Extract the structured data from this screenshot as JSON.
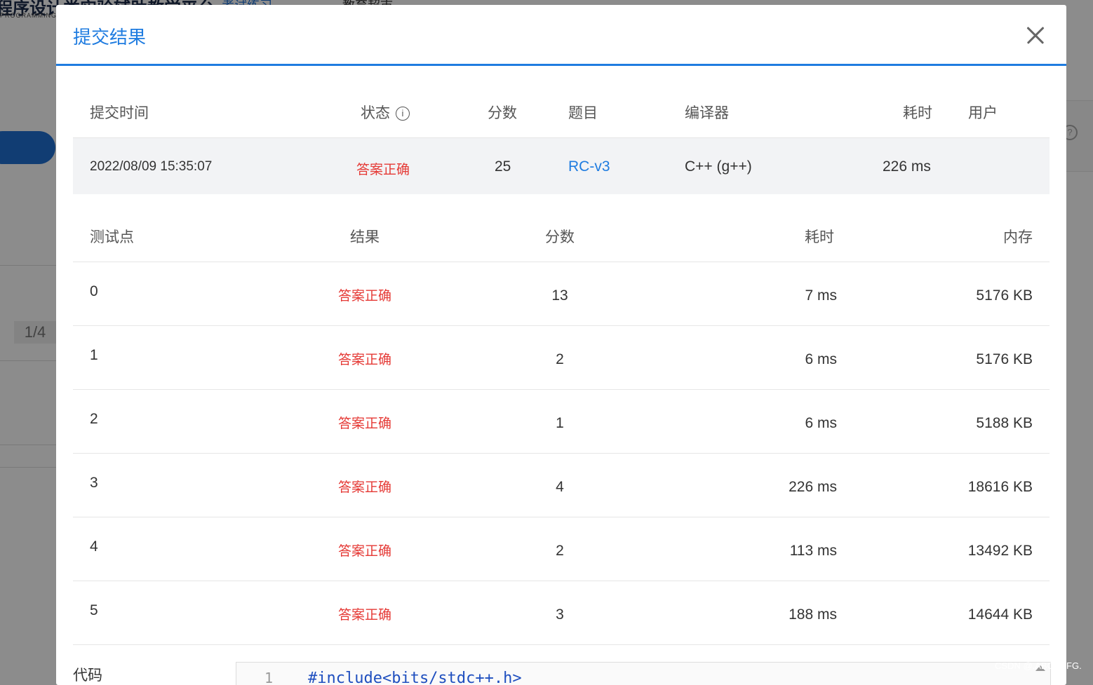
{
  "background": {
    "logo_main": "程序设计类实验辅助教学平台",
    "logo_sub": "PROGRAMMING TEACHING",
    "nav_active": "考试练习",
    "nav_other": "教育超市",
    "page_indicator": "1/4"
  },
  "modal": {
    "title": "提交结果",
    "summary": {
      "headers": {
        "time": "提交时间",
        "status": "状态",
        "score": "分数",
        "problem": "题目",
        "compiler": "编译器",
        "duration": "耗时",
        "user": "用户"
      },
      "row": {
        "time": "2022/08/09 15:35:07",
        "status": "答案正确",
        "score": "25",
        "problem": "RC-v3",
        "compiler": "C++ (g++)",
        "duration": "226 ms",
        "user": ""
      }
    },
    "testpoints": {
      "headers": {
        "id": "测试点",
        "result": "结果",
        "score": "分数",
        "duration": "耗时",
        "memory": "内存"
      },
      "rows": [
        {
          "id": "0",
          "result": "答案正确",
          "score": "13",
          "duration": "7 ms",
          "memory": "5176 KB"
        },
        {
          "id": "1",
          "result": "答案正确",
          "score": "2",
          "duration": "6 ms",
          "memory": "5176 KB"
        },
        {
          "id": "2",
          "result": "答案正确",
          "score": "1",
          "duration": "6 ms",
          "memory": "5188 KB"
        },
        {
          "id": "3",
          "result": "答案正确",
          "score": "4",
          "duration": "226 ms",
          "memory": "18616 KB"
        },
        {
          "id": "4",
          "result": "答案正确",
          "score": "2",
          "duration": "113 ms",
          "memory": "13492 KB"
        },
        {
          "id": "5",
          "result": "答案正确",
          "score": "3",
          "duration": "188 ms",
          "memory": "14644 KB"
        }
      ]
    },
    "code": {
      "label": "代码",
      "line_no": "1",
      "first_line": "#include<bits/stdc++.h>"
    }
  },
  "watermark": "CSDN @.ABCDEFG.",
  "colors": {
    "accent": "#1f7ce0",
    "accepted": "#e53935"
  }
}
